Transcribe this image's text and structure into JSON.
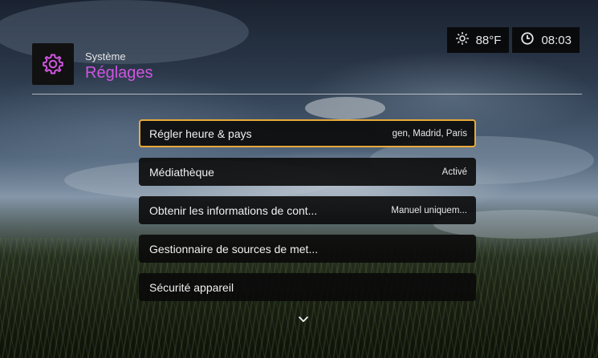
{
  "header": {
    "subtitle": "Système",
    "title": "Réglages",
    "app_icon": "gear-icon"
  },
  "status": {
    "weather_icon": "sun-icon",
    "temperature": "88°F",
    "clock_icon": "clock-icon",
    "time": "08:03"
  },
  "menu": {
    "items": [
      {
        "label": "Régler heure & pays",
        "value": "gen, Madrid, Paris",
        "selected": true
      },
      {
        "label": "Médiathèque",
        "value": "Activé",
        "selected": false
      },
      {
        "label": "Obtenir les informations de cont...",
        "value": "Manuel uniquem...",
        "selected": false
      },
      {
        "label": "Gestionnaire de sources de met...",
        "value": "",
        "selected": false
      },
      {
        "label": "Sécurité appareil",
        "value": "",
        "selected": false
      }
    ],
    "scroll_icon": "chevron-down-icon"
  },
  "colors": {
    "accent_title": "#d055e0",
    "selection_border": "#e7a93a"
  }
}
